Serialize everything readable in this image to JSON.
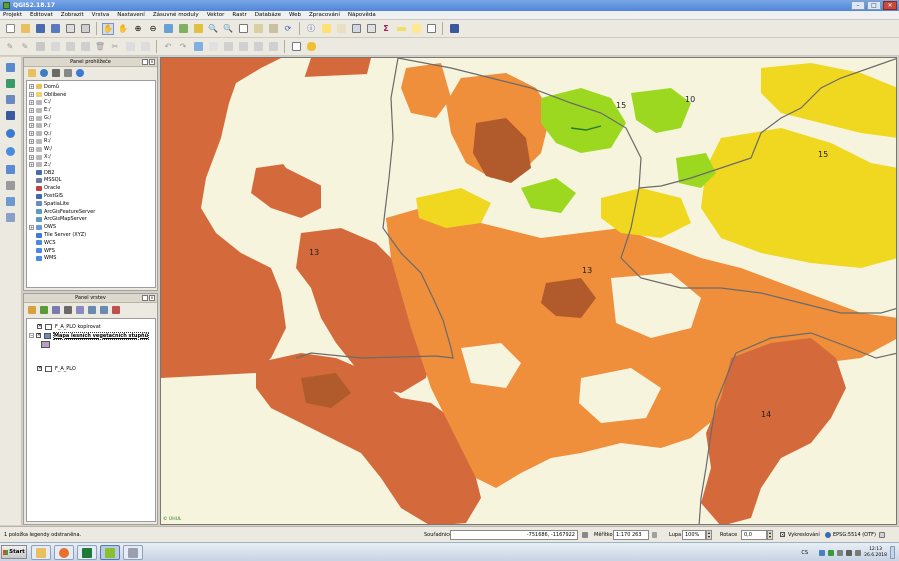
{
  "window": {
    "title": "QGIS2.18.17"
  },
  "menu": [
    "Projekt",
    "Editovat",
    "Zobrazit",
    "Vrstva",
    "Nastavení",
    "Zásuvné moduly",
    "Vektor",
    "Rastr",
    "Databáze",
    "Web",
    "Zpracování",
    "Nápověda"
  ],
  "browser_panel": {
    "title": "Panel prohlížeče",
    "items": [
      {
        "label": "Domů",
        "icon": "home-folder-icon",
        "expandable": true
      },
      {
        "label": "Oblíbené",
        "icon": "favorites-icon",
        "expandable": true
      },
      {
        "label": "C:/",
        "icon": "drive-icon",
        "expandable": true
      },
      {
        "label": "E:/",
        "icon": "drive-icon",
        "expandable": true
      },
      {
        "label": "G:/",
        "icon": "drive-icon",
        "expandable": true
      },
      {
        "label": "P:/",
        "icon": "drive-icon",
        "expandable": true
      },
      {
        "label": "Q:/",
        "icon": "drive-icon",
        "expandable": true
      },
      {
        "label": "R:/",
        "icon": "drive-icon",
        "expandable": true
      },
      {
        "label": "W:/",
        "icon": "drive-icon",
        "expandable": true
      },
      {
        "label": "X:/",
        "icon": "drive-icon",
        "expandable": true
      },
      {
        "label": "Z:/",
        "icon": "drive-icon",
        "expandable": true
      },
      {
        "label": "DB2",
        "icon": "db2-icon",
        "expandable": false
      },
      {
        "label": "MSSQL",
        "icon": "mssql-icon",
        "expandable": false
      },
      {
        "label": "Oracle",
        "icon": "oracle-icon",
        "expandable": false
      },
      {
        "label": "PostGIS",
        "icon": "postgis-icon",
        "expandable": false
      },
      {
        "label": "SpatiaLite",
        "icon": "spatialite-icon",
        "expandable": false
      },
      {
        "label": "ArcGisFeatureServer",
        "icon": "arcgis-icon",
        "expandable": false
      },
      {
        "label": "ArcGisMapServer",
        "icon": "arcgis-icon",
        "expandable": false
      },
      {
        "label": "OWS",
        "icon": "ows-icon",
        "expandable": true
      },
      {
        "label": "Tile Server (XYZ)",
        "icon": "tile-server-icon",
        "expandable": false
      },
      {
        "label": "WCS",
        "icon": "wcs-icon",
        "expandable": false
      },
      {
        "label": "WFS",
        "icon": "wfs-icon",
        "expandable": false
      },
      {
        "label": "WMS",
        "icon": "wms-icon",
        "expandable": false
      }
    ]
  },
  "layers_panel": {
    "title": "Panel vrstev",
    "layers": [
      {
        "label": "F_A_PLO kopírovat",
        "checked": true,
        "selected": false
      },
      {
        "label": "Mapa lesních vegetačních stupňů",
        "checked": true,
        "selected": true
      },
      {
        "label": "F_A_PLO",
        "checked": true,
        "selected": false
      }
    ]
  },
  "map": {
    "labels": [
      "15",
      "10",
      "15",
      "13",
      "13",
      "14"
    ],
    "credit": "© ÚHUL",
    "colors": {
      "background": "#f7f4dd",
      "dark_orange": "#d46a3c",
      "mid_orange": "#ef8f3c",
      "brown": "#b15a2c",
      "yellow": "#f0d820",
      "green": "#9cd820",
      "boundary": "#6a6a6a"
    }
  },
  "status": {
    "message": "1 položka legendy odstraněna.",
    "coord_label": "Souřadnice",
    "coord_value": "-751686, -1167922",
    "scale_label": "Měřítko",
    "scale_value": "1:170 263",
    "magnifier_label": "Lupa",
    "magnifier_value": "100%",
    "rotation_label": "Rotace",
    "rotation_value": "0,0",
    "render_label": "Vykreslování",
    "crs_label": "EPSG:5514 (OTF)"
  },
  "taskbar": {
    "start_label": "Start",
    "lang": "CS",
    "time": "12:13",
    "date": "26.6.2018"
  }
}
